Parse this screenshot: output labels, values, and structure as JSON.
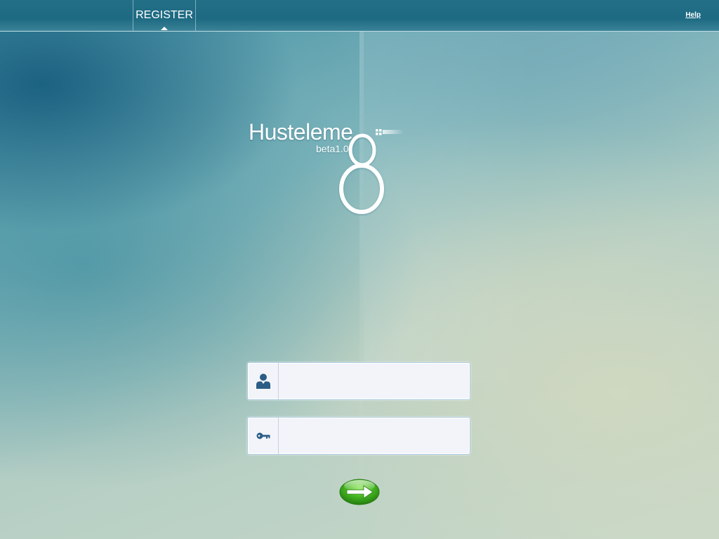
{
  "topbar": {
    "register_label": "REGISTER",
    "help_label": "Help"
  },
  "logo": {
    "name": "Husteleme",
    "version": "beta1.0",
    "number": "8"
  },
  "login_form": {
    "username": {
      "value": "",
      "placeholder": "",
      "icon": "user-icon"
    },
    "password": {
      "value": "",
      "placeholder": "",
      "icon": "key-icon"
    },
    "submit_icon": "arrow-right-icon"
  },
  "colors": {
    "topbar": "#1d6a82",
    "field_border": "#a9c9de",
    "field_background": "#f2f4fa",
    "icon": "#2c5d86",
    "go_button": "#3fae1f"
  }
}
